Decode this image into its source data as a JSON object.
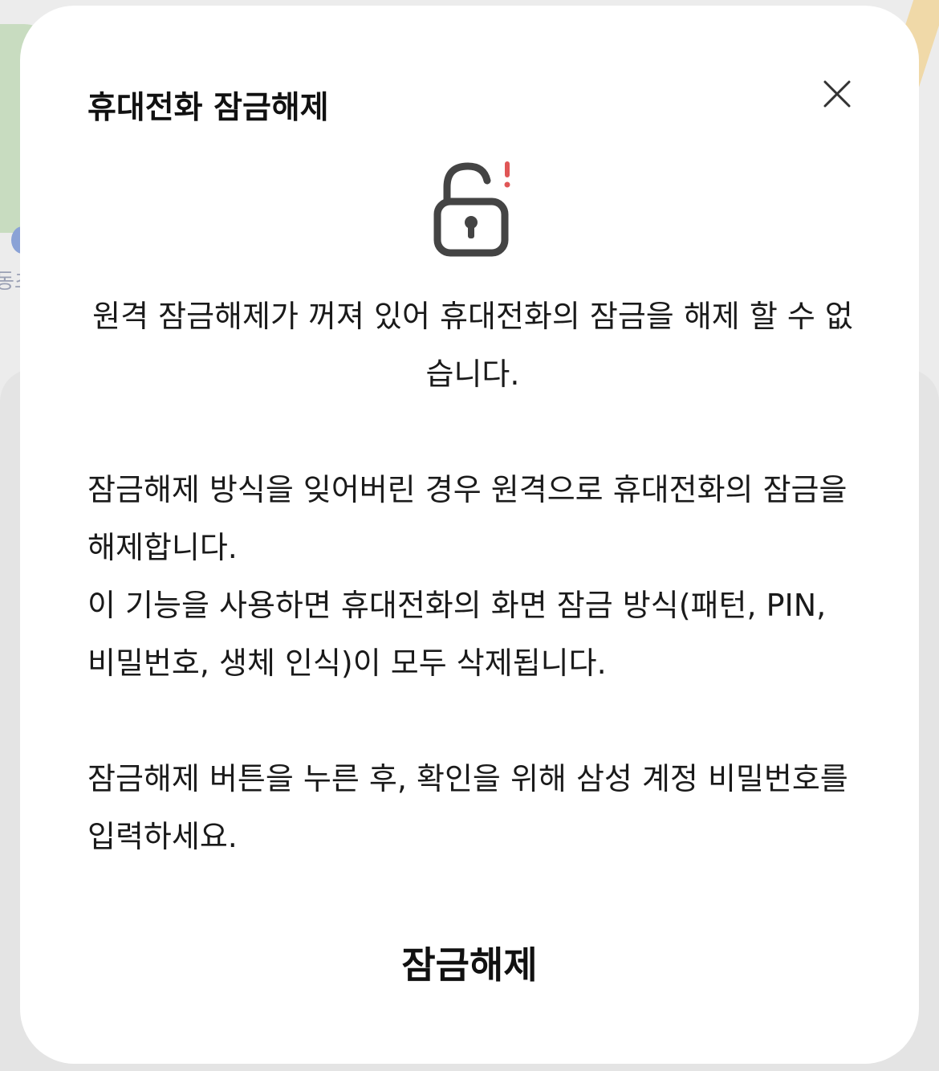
{
  "dialog": {
    "title": "휴대전화 잠금해제",
    "close_icon": "close-icon",
    "lock_icon": "unlocked-padlock-warning-icon",
    "warning_mark": "!",
    "warning_text": "원격 잠금해제가 꺼져 있어 휴대전화의 잠금을 해제 할 수 없습니다.",
    "description_line1": "잠금해제 방식을 잊어버린 경우 원격으로 휴대전화의 잠금을 해제합니다.",
    "description_line2": "이 기능을 사용하면 휴대전화의 화면 잠금 방식(패턴, PIN, 비밀번호, 생체 인식)이 모두 삭제됩니다.",
    "instruction": "잠금해제 버튼을 누른 후, 확인을 위해 삼성 계정 비밀번호를 입력하세요.",
    "unlock_button_label": "잠금해제"
  },
  "background": {
    "map_label_fragment": "동초"
  },
  "colors": {
    "dialog_bg": "#ffffff",
    "text": "#1a1a1a",
    "icon": "#444444",
    "warning_accent": "#e05656"
  }
}
